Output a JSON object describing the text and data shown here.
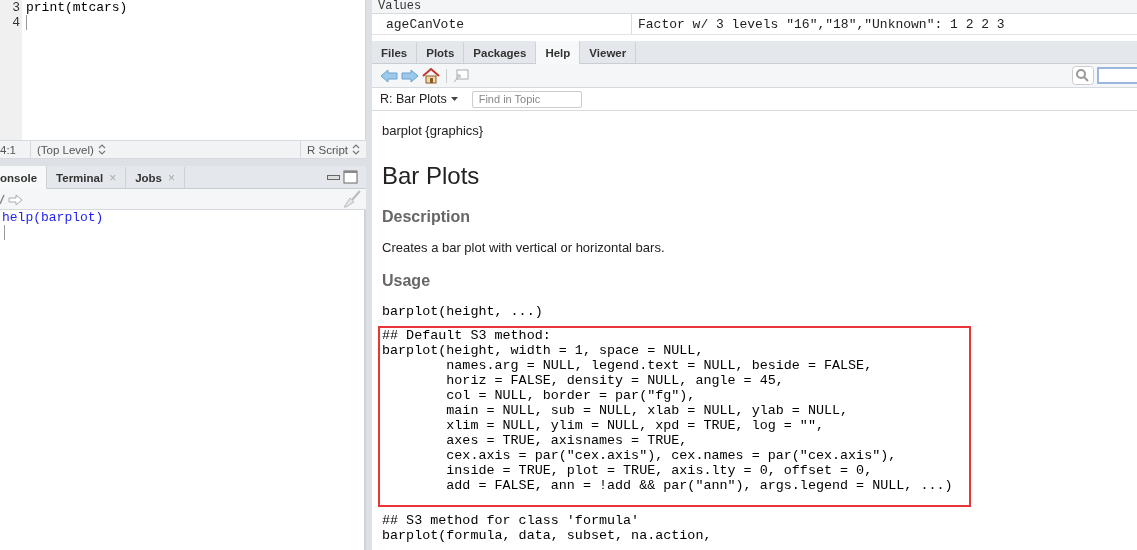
{
  "source_editor": {
    "lines": [
      {
        "number": "3",
        "code": "print(mtcars)"
      },
      {
        "number": "4",
        "cursor": true
      }
    ],
    "status_bar": {
      "position": "4:1",
      "scope": "(Top Level)",
      "file_type": "R Script"
    }
  },
  "console": {
    "tabs": [
      {
        "label": "onsole",
        "selected": true
      },
      {
        "label": "Terminal",
        "close": "×",
        "selected": false
      },
      {
        "label": "Jobs",
        "close": "×",
        "selected": false
      }
    ],
    "lines": [
      "help(barplot)"
    ]
  },
  "environment": {
    "section": "Values",
    "rows": [
      {
        "name": "ageCanVote",
        "value": "Factor w/ 3 levels \"16\",\"18\",\"Unknown\": 1 2 2 3"
      }
    ]
  },
  "help": {
    "tabs": [
      {
        "label": "Files",
        "selected": false
      },
      {
        "label": "Plots",
        "selected": false
      },
      {
        "label": "Packages",
        "selected": false
      },
      {
        "label": "Help",
        "selected": true
      },
      {
        "label": "Viewer",
        "selected": false
      }
    ],
    "topic": "R: Bar Plots",
    "find_placeholder": "Find in Topic",
    "package_line": "barplot {graphics}",
    "title": "Bar Plots",
    "sections": [
      {
        "kind": "heading",
        "text": "Description"
      },
      {
        "kind": "paragraph",
        "text": "Creates a bar plot with vertical or horizontal bars."
      },
      {
        "kind": "heading",
        "text": "Usage"
      },
      {
        "kind": "code",
        "highlighted": false,
        "lines": [
          "barplot(height, ...)"
        ]
      },
      {
        "kind": "code",
        "highlighted": true,
        "lines": [
          "## Default S3 method:",
          "barplot(height, width = 1, space = NULL,",
          "        names.arg = NULL, legend.text = NULL, beside = FALSE,",
          "        horiz = FALSE, density = NULL, angle = 45,",
          "        col = NULL, border = par(\"fg\"),",
          "        main = NULL, sub = NULL, xlab = NULL, ylab = NULL,",
          "        xlim = NULL, ylim = NULL, xpd = TRUE, log = \"\",",
          "        axes = TRUE, axisnames = TRUE,",
          "        cex.axis = par(\"cex.axis\"), cex.names = par(\"cex.axis\"),",
          "        inside = TRUE, plot = TRUE, axis.lty = 0, offset = 0,",
          "        add = FALSE, ann = !add && par(\"ann\"), args.legend = NULL, ...)"
        ]
      },
      {
        "kind": "code",
        "highlighted": false,
        "lines": [
          "## S3 method for class 'formula'",
          "barplot(formula, data, subset, na.action,"
        ]
      }
    ]
  }
}
